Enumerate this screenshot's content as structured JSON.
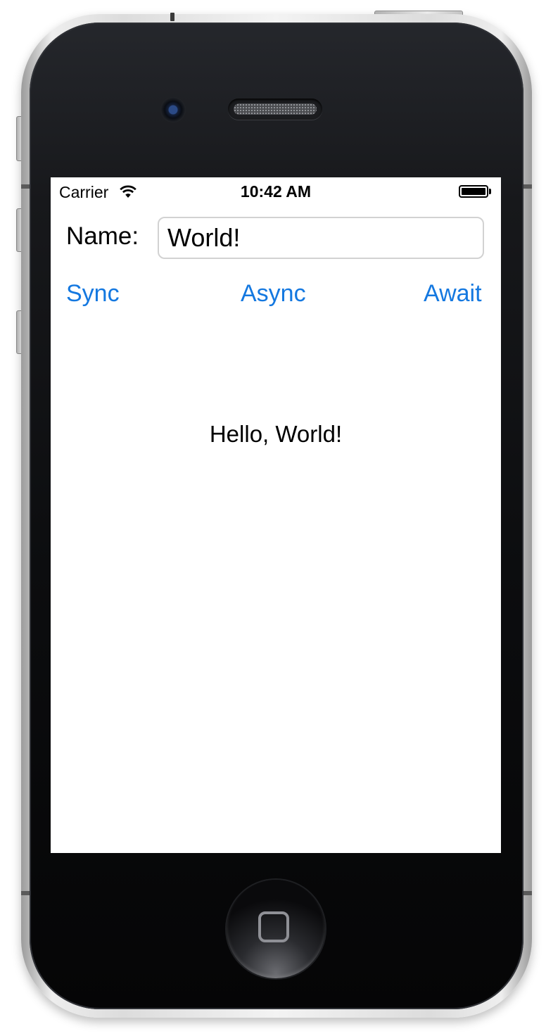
{
  "status_bar": {
    "carrier": "Carrier",
    "time": "10:42 AM",
    "battery_level": 1.0
  },
  "form": {
    "name_label": "Name:",
    "name_value": "World!"
  },
  "buttons": {
    "sync_label": "Sync",
    "async_label": "Async",
    "await_label": "Await"
  },
  "result_text": "Hello, World!",
  "colors": {
    "accent": "#1478e0",
    "screen_background": "#ffffff",
    "device_bezel": "#0c0d0f"
  },
  "icons": [
    "wifi-icon",
    "battery-icon",
    "home-button",
    "camera",
    "speaker-grille"
  ]
}
